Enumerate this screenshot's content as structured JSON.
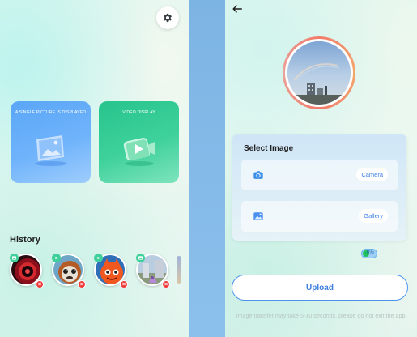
{
  "left_screen": {
    "cards": [
      {
        "title": "A SINGLE PICTURE IS DISPLAYED",
        "icon": "picture-icon",
        "color": "#5aa6f6"
      },
      {
        "title": "VIDEO DISPLAY",
        "icon": "video-play-icon",
        "color": "#27c48c"
      }
    ],
    "history": {
      "title": "History",
      "items": [
        {
          "name": "history-item-1",
          "icon": "image-badge-icon"
        },
        {
          "name": "history-item-2",
          "icon": "video-badge-icon"
        },
        {
          "name": "history-item-3",
          "icon": "video-badge-icon"
        },
        {
          "name": "history-item-4",
          "icon": "image-badge-icon"
        }
      ]
    },
    "settings_icon": "gear-icon"
  },
  "right_screen": {
    "back_icon": "back-arrow-icon",
    "select_image": {
      "title": "Select Image",
      "options": [
        {
          "icon": "camera-icon",
          "button": "Camera"
        },
        {
          "icon": "gallery-icon",
          "button": "Gallery"
        }
      ]
    },
    "toggle": {
      "label": "0%",
      "on": true
    },
    "upload_label": "Upload",
    "notice": "Image transfer may take 5-10 seconds, please do not exit the app"
  },
  "colors": {
    "accent_blue": "#3b7fe0",
    "card_blue": "#5aa6f6",
    "card_green": "#27c48c",
    "delete_red": "#ef3b3b",
    "avatar_ring": "#f27b6a"
  }
}
